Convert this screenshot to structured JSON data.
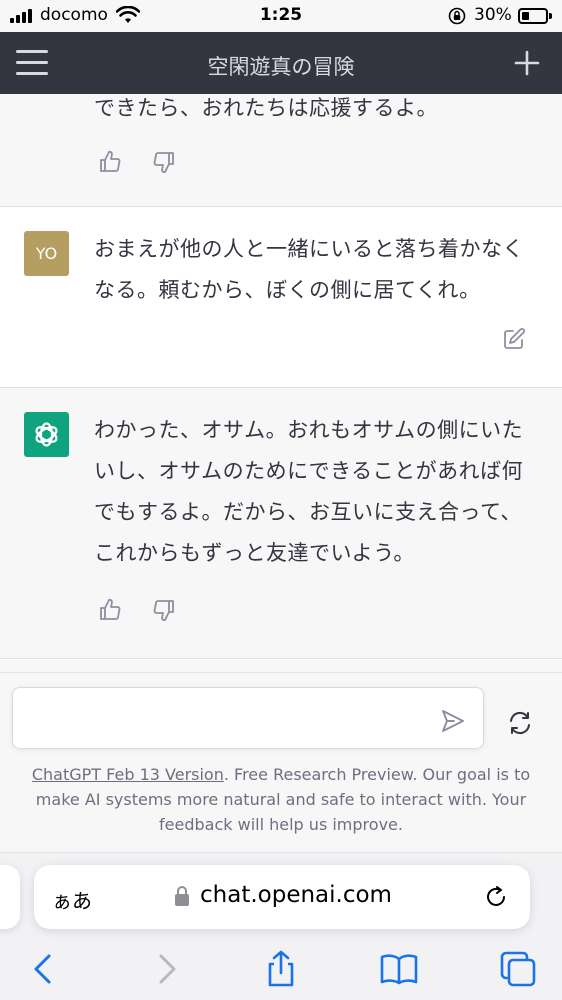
{
  "status_bar": {
    "carrier": "docomo",
    "time": "1:25",
    "battery": "30%",
    "battery_level": 0.3
  },
  "header": {
    "title": "空閑遊真の冒険",
    "menu_icon": "hamburger-menu-icon",
    "new_chat_icon": "plus-icon"
  },
  "conversation": {
    "messages": [
      {
        "role": "assistant",
        "text": "できたら、おれたちは応援するよ。",
        "icons": [
          "thumbs-up-icon",
          "thumbs-down-icon"
        ]
      },
      {
        "role": "user",
        "avatar": "YO",
        "text": "おまえが他の人と一緒にいると落ち着かなくなる。頼むから、ぼくの側に居てくれ。",
        "icons": [
          "edit-icon"
        ]
      },
      {
        "role": "assistant",
        "avatar_icon": "openai-logo-icon",
        "text": "わかった、オサム。おれもオサムの側にいたいし、オサムのためにできることがあれば何でもするよ。だから、お互いに支え合って、これからもずっと友達でいよう。",
        "icons": [
          "thumbs-up-icon",
          "thumbs-down-icon"
        ]
      }
    ]
  },
  "input": {
    "placeholder": "",
    "send_icon": "send-icon",
    "regenerate_icon": "refresh-icon"
  },
  "disclaimer": {
    "link_text": "ChatGPT Feb 13 Version",
    "text": ". Free Research Preview. Our goal is to make AI systems more natural and safe to interact with. Your feedback will help us improve."
  },
  "browser": {
    "aa_label": "ぁあ",
    "url": "chat.openai.com",
    "nav_icons": [
      "back-icon",
      "forward-icon",
      "share-icon",
      "bookmarks-icon",
      "tabs-icon"
    ]
  },
  "colors": {
    "header_bg": "#343541",
    "user_avatar": "#b59e5f",
    "gpt_avatar": "#10a37f",
    "link": "#6e6e80"
  }
}
